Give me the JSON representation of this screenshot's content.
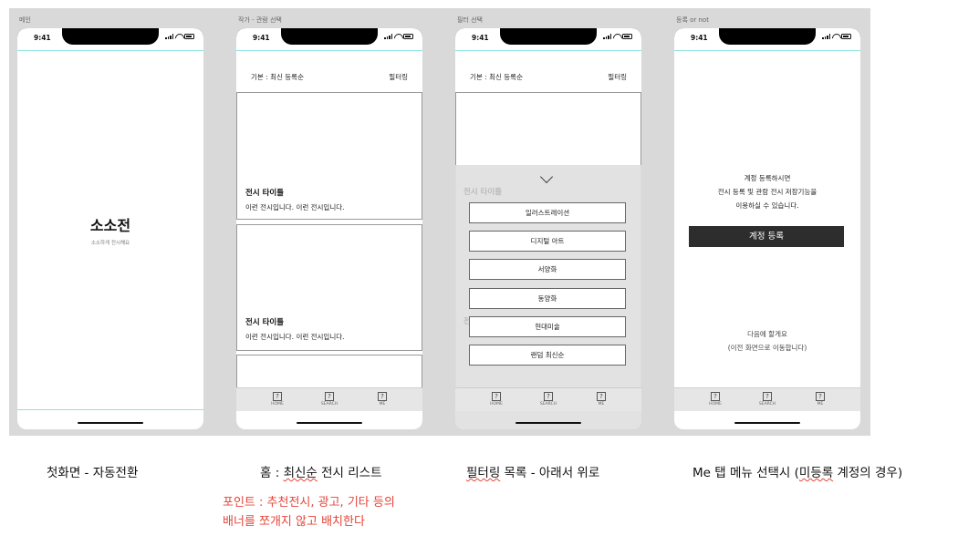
{
  "frames": [
    {
      "label": "메인"
    },
    {
      "label": "작가 - 관람 선택"
    },
    {
      "label": "필터 선택"
    },
    {
      "label": "등록 or not"
    }
  ],
  "status_time": "9:41",
  "splash": {
    "title": "소소전",
    "subtitle": "소소하게 전시해요"
  },
  "list": {
    "sort_label": "기본 : 최신 등록순",
    "filter_label": "필터링",
    "cards": [
      {
        "title": "전시 타이틀",
        "desc": "이런 전시입니다. 이런 전시입니다."
      },
      {
        "title": "전시 타이틀",
        "desc": "이런 전시입니다. 이런 전시입니다."
      }
    ]
  },
  "filter": {
    "sort_label": "기본 : 최신 등록순",
    "filter_label": "필터링",
    "ghost_title": "전시 타이틀",
    "ghost_title_2": "전",
    "options": [
      "일러스트레이션",
      "디지털 아트",
      "서양화",
      "동양화",
      "현대미술",
      "랜덤 최신순"
    ]
  },
  "tabs": [
    {
      "icon": "?",
      "label": "HOME"
    },
    {
      "icon": "?",
      "label": "SEARCH"
    },
    {
      "icon": "?",
      "label": "ME"
    }
  ],
  "me": {
    "message_lines": [
      "계정 등록하시면",
      "전시 등록 및 관람 전시 저장기능을",
      "이용하실 수 있습니다."
    ],
    "register_button": "계정 등록",
    "later_lines": [
      "다음에 할게요",
      "(이전 화면으로 이동합니다)"
    ]
  },
  "captions": {
    "c1": "첫화면 - 자동전환",
    "c2_prefix": "홈 : ",
    "c2_mark": "최신순",
    "c2_suffix": " 전시 리스트",
    "c3_mark": "필터링",
    "c3_suffix": " 목록 - 아래서 위로",
    "c4_prefix": "Me 탭 메뉴 선택시 (",
    "c4_mark": "미등록",
    "c4_suffix": " 계정의 경우)"
  },
  "note": {
    "line1": "포인트 : 추천전시, 광고, 기타 등의",
    "line2": "배너를 쪼개지 않고 배치한다"
  },
  "colors": {
    "note": "#e5453a",
    "guide": "#8fe3e3",
    "button": "#2d2d2d"
  }
}
